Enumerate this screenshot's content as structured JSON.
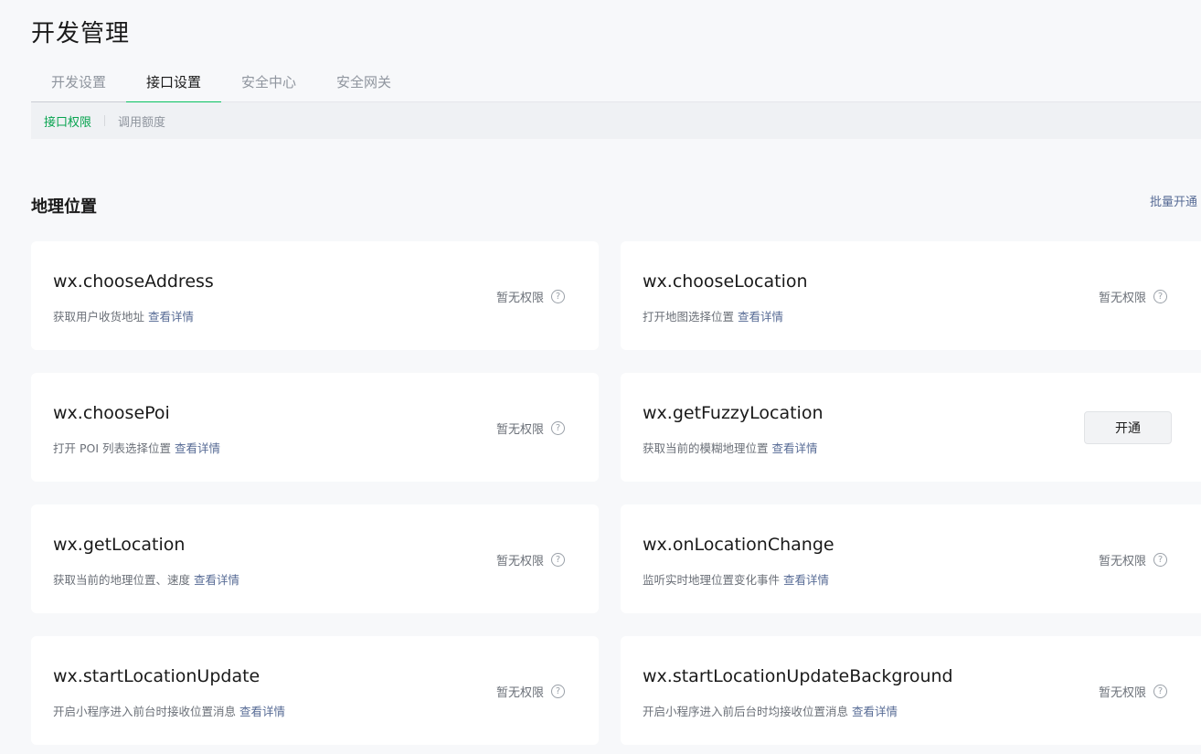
{
  "page": {
    "title": "开发管理"
  },
  "tabs": [
    {
      "label": "开发设置"
    },
    {
      "label": "接口设置"
    },
    {
      "label": "安全中心"
    },
    {
      "label": "安全网关"
    }
  ],
  "subtabs": [
    {
      "label": "接口权限"
    },
    {
      "label": "调用额度"
    }
  ],
  "section": {
    "title": "地理位置",
    "bulk_action": "批量开通"
  },
  "detail_label": "查看详情",
  "apis": [
    {
      "name": "wx.chooseAddress",
      "desc": "获取用户收货地址",
      "status": "暂无权限"
    },
    {
      "name": "wx.chooseLocation",
      "desc": "打开地图选择位置",
      "status": "暂无权限"
    },
    {
      "name": "wx.choosePoi",
      "desc": "打开 POI 列表选择位置",
      "status": "暂无权限"
    },
    {
      "name": "wx.getFuzzyLocation",
      "desc": "获取当前的模糊地理位置",
      "action": "开通"
    },
    {
      "name": "wx.getLocation",
      "desc": "获取当前的地理位置、速度",
      "status": "暂无权限"
    },
    {
      "name": "wx.onLocationChange",
      "desc": "监听实时地理位置变化事件",
      "status": "暂无权限"
    },
    {
      "name": "wx.startLocationUpdate",
      "desc": "开启小程序进入前台时接收位置消息",
      "status": "暂无权限"
    },
    {
      "name": "wx.startLocationUpdateBackground",
      "desc": "开启小程序进入前后台时均接收位置消息",
      "status": "暂无权限"
    }
  ],
  "icons": {
    "help": "question-circle-icon"
  },
  "colors": {
    "accent": "#07c160",
    "link": "#576b95"
  }
}
